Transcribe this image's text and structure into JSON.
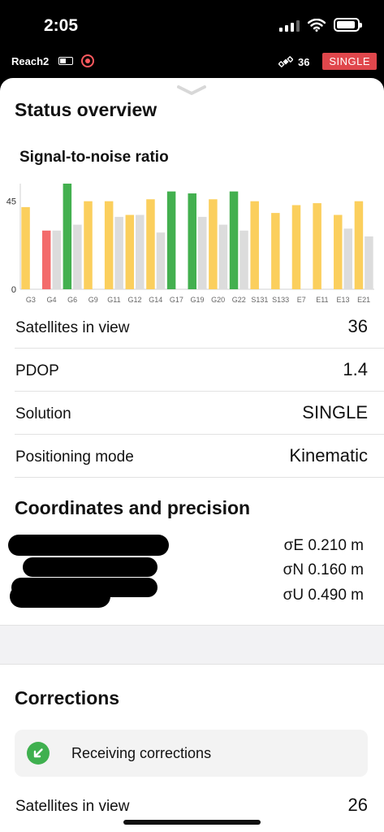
{
  "status_bar": {
    "time": "2:05"
  },
  "device": {
    "name": "Reach2",
    "satellites": "36",
    "solution_badge": "SINGLE"
  },
  "sections": {
    "status_title": "Status overview",
    "snr_title": "Signal-to-noise ratio",
    "coords_title": "Coordinates and precision",
    "corrections_title": "Corrections"
  },
  "chart_data": {
    "type": "bar",
    "categories": [
      "G3",
      "G4",
      "G6",
      "G9",
      "G11",
      "G12",
      "G14",
      "G17",
      "G19",
      "G20",
      "G22",
      "S131",
      "S133",
      "E7",
      "E11",
      "E13",
      "E21"
    ],
    "y_ticks": [
      "0",
      "45"
    ],
    "ylim": [
      0,
      54
    ],
    "series": [
      {
        "values": [
          42,
          30,
          54,
          45,
          45,
          38,
          46,
          50,
          49,
          46,
          50,
          45,
          39,
          43,
          44,
          38,
          45
        ]
      },
      {
        "values": [
          null,
          30,
          33,
          null,
          37,
          38,
          29,
          null,
          37,
          33,
          30,
          null,
          null,
          null,
          null,
          31,
          27
        ]
      }
    ],
    "rover_colors": [
      "#fbcf5d",
      "#f36b6b",
      "#43b04f",
      "#fbcf5d",
      "#fbcf5d",
      "#fbcf5d",
      "#fbcf5d",
      "#43b04f",
      "#43b04f",
      "#fbcf5d",
      "#43b04f",
      "#fbcf5d",
      "#fbcf5d",
      "#fbcf5d",
      "#fbcf5d",
      "#fbcf5d",
      "#fbcf5d"
    ],
    "base_color": "#dcdcdc",
    "grid": false
  },
  "status_rows": [
    {
      "label": "Satellites in view",
      "value": "36"
    },
    {
      "label": "PDOP",
      "value": "1.4"
    },
    {
      "label": "Solution",
      "value": "SINGLE"
    },
    {
      "label": "Positioning mode",
      "value": "Kinematic"
    }
  ],
  "precision": {
    "e": "σE 0.210 m",
    "n": "σN 0.160 m",
    "u": "σU 0.490 m"
  },
  "corrections": {
    "status": "Receiving corrections",
    "sat_label": "Satellites in view",
    "sat_value": "26"
  }
}
